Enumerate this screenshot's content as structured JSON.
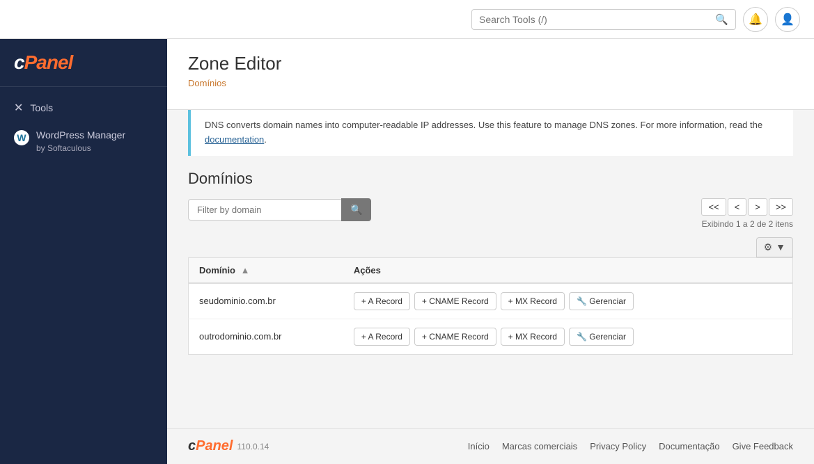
{
  "header": {
    "search_placeholder": "Search Tools (/)",
    "search_value": ""
  },
  "sidebar": {
    "logo": "cPanel",
    "items": [
      {
        "id": "tools",
        "label": "Tools",
        "icon": "✕"
      },
      {
        "id": "wordpress-manager",
        "label": "WordPress Manager",
        "sublabel": "by Softaculous",
        "icon": "W"
      }
    ]
  },
  "page": {
    "title": "Zone Editor",
    "breadcrumb": "Domínios",
    "info_text": "DNS converts domain names into computer-readable IP addresses. Use this feature to manage DNS zones. For more information, read the",
    "info_link_text": "documentation",
    "info_link_end": ".",
    "section_title": "Domínios",
    "filter_placeholder": "Filter by domain",
    "pagination": {
      "first": "<<",
      "prev": "<",
      "next": ">",
      "last": ">>",
      "info": "Exibindo 1 a 2 de 2 itens"
    },
    "table": {
      "columns": [
        {
          "label": "Domínio",
          "sort": "▲"
        },
        {
          "label": "Ações"
        }
      ],
      "rows": [
        {
          "domain": "seudominio.com.br",
          "actions": [
            {
              "label": "+ A Record"
            },
            {
              "label": "+ CNAME Record"
            },
            {
              "label": "+ MX Record"
            },
            {
              "label": "🔧 Gerenciar"
            }
          ]
        },
        {
          "domain": "outrodominio.com.br",
          "actions": [
            {
              "label": "+ A Record"
            },
            {
              "label": "+ CNAME Record"
            },
            {
              "label": "+ MX Record"
            },
            {
              "label": "🔧 Gerenciar"
            }
          ]
        }
      ]
    }
  },
  "footer": {
    "logo": "cPanel",
    "version": "110.0.14",
    "links": [
      {
        "label": "Início"
      },
      {
        "label": "Marcas comerciais"
      },
      {
        "label": "Privacy Policy"
      },
      {
        "label": "Documentação"
      },
      {
        "label": "Give Feedback"
      }
    ]
  }
}
